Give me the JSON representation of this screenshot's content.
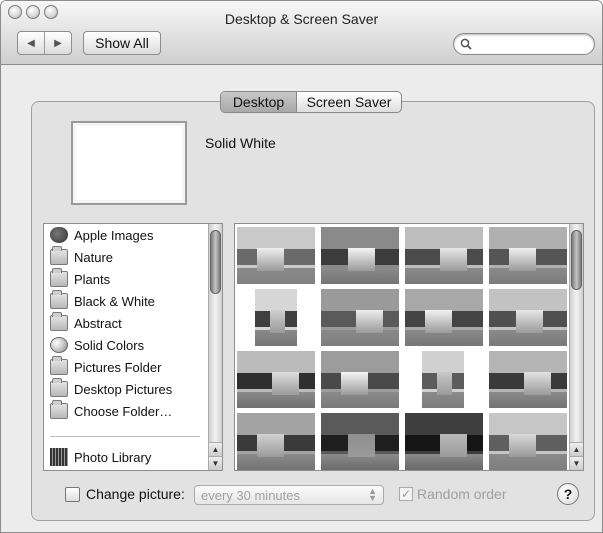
{
  "window": {
    "title": "Desktop & Screen Saver"
  },
  "toolbar": {
    "back_icon": "back-arrow-icon",
    "forward_icon": "forward-arrow-icon",
    "show_all_label": "Show All",
    "search_placeholder": "",
    "search_icon": "search-icon"
  },
  "tabs": [
    {
      "label": "Desktop",
      "selected": true
    },
    {
      "label": "Screen Saver",
      "selected": false
    }
  ],
  "preview": {
    "name": "Solid White",
    "color": "#ffffff"
  },
  "sources": [
    {
      "label": "Apple Images",
      "icon": "apple-icon"
    },
    {
      "label": "Nature",
      "icon": "folder-icon"
    },
    {
      "label": "Plants",
      "icon": "folder-icon"
    },
    {
      "label": "Black & White",
      "icon": "folder-icon"
    },
    {
      "label": "Abstract",
      "icon": "folder-icon"
    },
    {
      "label": "Solid Colors",
      "icon": "disc-icon"
    },
    {
      "label": "Pictures Folder",
      "icon": "pictures-folder-icon"
    },
    {
      "label": "Desktop Pictures",
      "icon": "folder-icon"
    },
    {
      "label": "Choose Folder…",
      "icon": "folder-icon"
    },
    {
      "label": "Photo Library",
      "icon": "photo-library-icon"
    }
  ],
  "thumbnail_count": 16,
  "bottom": {
    "change_picture_label": "Change picture:",
    "change_picture_checked": false,
    "interval_value": "every 30 minutes",
    "random_order_label": "Random order",
    "random_order_checked": true,
    "help_label": "?"
  }
}
